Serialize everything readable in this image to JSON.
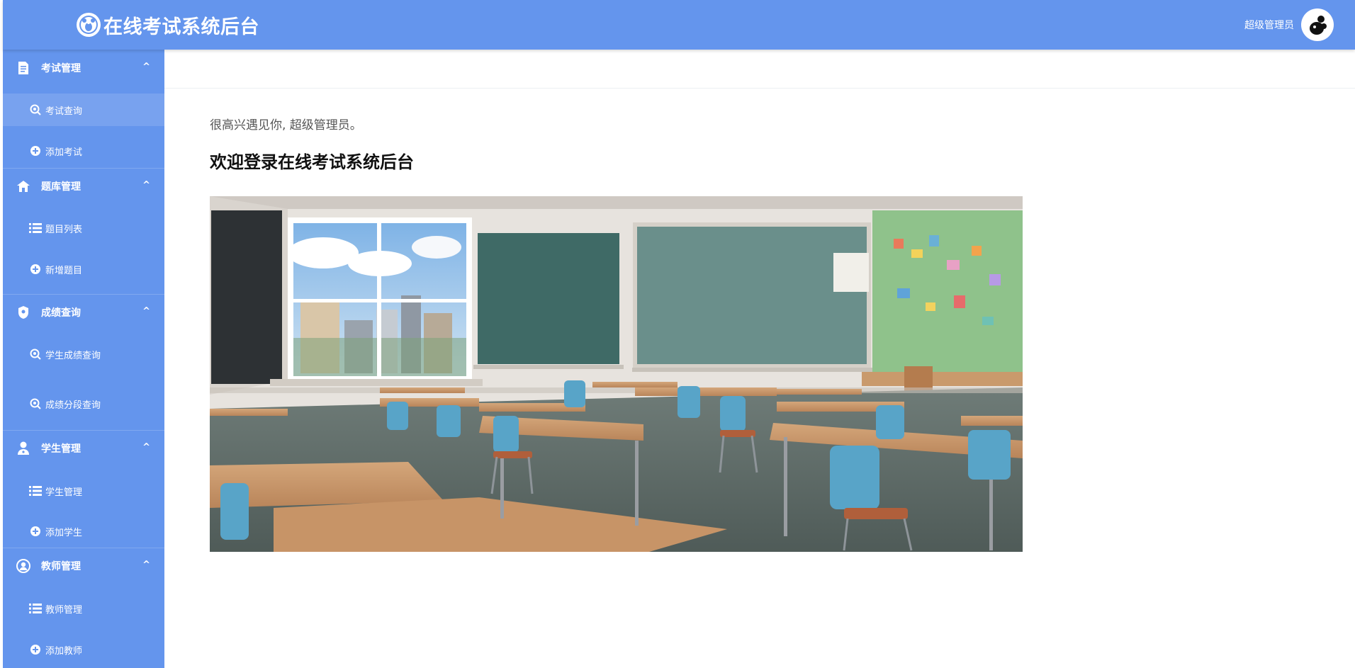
{
  "header": {
    "title": "在线考试系统后台",
    "logo_icon": "panda-logo-icon",
    "user_name": "超级管理员",
    "avatar_icon": "panda-avatar-icon",
    "bg_color": "#6495ed"
  },
  "sidebar": {
    "groups": [
      {
        "label": "考试管理",
        "icon": "document-icon",
        "items": [
          {
            "label": "考试查询",
            "icon": "search-icon",
            "active": true
          },
          {
            "label": "添加考试",
            "icon": "add-icon"
          }
        ]
      },
      {
        "label": "题库管理",
        "icon": "home-icon",
        "items": [
          {
            "label": "题目列表",
            "icon": "list-icon"
          },
          {
            "label": "新增题目",
            "icon": "add-icon"
          }
        ]
      },
      {
        "label": "成绩查询",
        "icon": "shield-icon",
        "items": [
          {
            "label": "学生成绩查询",
            "icon": "search-icon"
          },
          {
            "label": "成绩分段查询",
            "icon": "search-icon"
          }
        ]
      },
      {
        "label": "学生管理",
        "icon": "user-icon",
        "items": [
          {
            "label": "学生管理",
            "icon": "list-icon"
          },
          {
            "label": "添加学生",
            "icon": "add-icon"
          }
        ]
      },
      {
        "label": "教师管理",
        "icon": "teacher-icon",
        "items": [
          {
            "label": "教师管理",
            "icon": "list-icon"
          },
          {
            "label": "添加教师",
            "icon": "add-icon"
          }
        ]
      }
    ],
    "chevron": "^"
  },
  "main": {
    "greeting": "很高兴遇见你, 超级管理员。",
    "welcome": "欢迎登录在线考试系统后台",
    "hero_image": "classroom-illustration"
  }
}
